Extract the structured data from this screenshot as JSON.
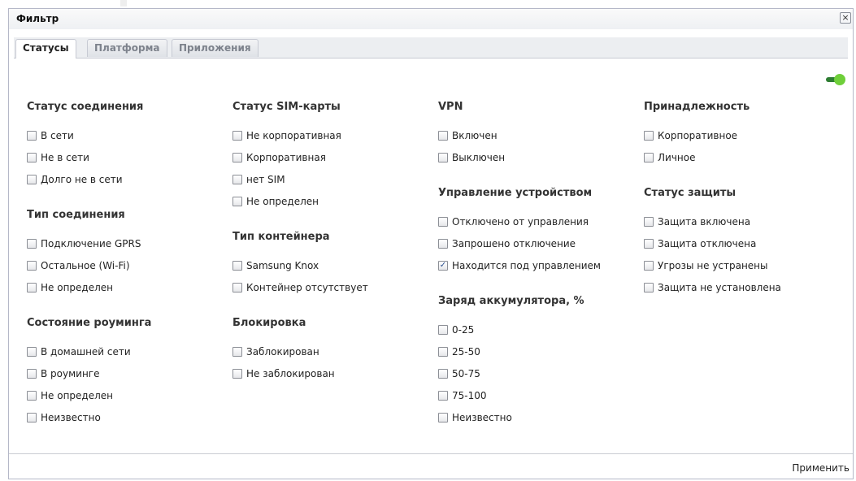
{
  "dialog": {
    "title": "Фильтр",
    "close_label": "×",
    "apply_label": "Применить"
  },
  "tabs": [
    {
      "label": "Статусы",
      "active": true
    },
    {
      "label": "Платформа",
      "active": false
    },
    {
      "label": "Приложения",
      "active": false
    }
  ],
  "toggle": {
    "on": true,
    "color": "#6fcf3a"
  },
  "columns": [
    {
      "groups": [
        {
          "title": "Статус соединения",
          "options": [
            {
              "label": "В сети",
              "checked": false
            },
            {
              "label": "Не в сети",
              "checked": false
            },
            {
              "label": "Долго не в сети",
              "checked": false
            }
          ]
        },
        {
          "title": "Тип соединения",
          "options": [
            {
              "label": "Подключение GPRS",
              "checked": false
            },
            {
              "label": "Остальное (Wi-Fi)",
              "checked": false
            },
            {
              "label": "Не определен",
              "checked": false
            }
          ]
        },
        {
          "title": "Состояние роуминга",
          "options": [
            {
              "label": "В домашней сети",
              "checked": false
            },
            {
              "label": "В роуминге",
              "checked": false
            },
            {
              "label": "Не определен",
              "checked": false
            },
            {
              "label": "Неизвестно",
              "checked": false
            }
          ]
        }
      ]
    },
    {
      "groups": [
        {
          "title": "Статус SIM-карты",
          "options": [
            {
              "label": "Не корпоративная",
              "checked": false
            },
            {
              "label": "Корпоративная",
              "checked": false
            },
            {
              "label": "нет SIM",
              "checked": false
            },
            {
              "label": "Не определен",
              "checked": false
            }
          ]
        },
        {
          "title": "Тип контейнера",
          "options": [
            {
              "label": "Samsung Knox",
              "checked": false
            },
            {
              "label": "Контейнер отсутствует",
              "checked": false
            }
          ]
        },
        {
          "title": "Блокировка",
          "options": [
            {
              "label": "Заблокирован",
              "checked": false
            },
            {
              "label": "Не заблокирован",
              "checked": false
            }
          ]
        }
      ]
    },
    {
      "groups": [
        {
          "title": "VPN",
          "options": [
            {
              "label": "Включен",
              "checked": false
            },
            {
              "label": "Выключен",
              "checked": false
            }
          ]
        },
        {
          "title": "Управление устройством",
          "options": [
            {
              "label": "Отключено от управления",
              "checked": false
            },
            {
              "label": "Запрошено отключение",
              "checked": false
            },
            {
              "label": "Находится под управлением",
              "checked": true
            }
          ]
        },
        {
          "title": "Заряд аккумулятора, %",
          "options": [
            {
              "label": "0-25",
              "checked": false
            },
            {
              "label": "25-50",
              "checked": false
            },
            {
              "label": "50-75",
              "checked": false
            },
            {
              "label": "75-100",
              "checked": false
            },
            {
              "label": "Неизвестно",
              "checked": false
            }
          ]
        }
      ]
    },
    {
      "groups": [
        {
          "title": "Принадлежность",
          "options": [
            {
              "label": "Корпоративное",
              "checked": false
            },
            {
              "label": "Личное",
              "checked": false
            }
          ]
        },
        {
          "title": "Статус защиты",
          "options": [
            {
              "label": "Защита включена",
              "checked": false
            },
            {
              "label": "Защита отключена",
              "checked": false
            },
            {
              "label": "Угрозы не устранены",
              "checked": false
            },
            {
              "label": "Защита не установлена",
              "checked": false
            }
          ]
        }
      ]
    }
  ]
}
